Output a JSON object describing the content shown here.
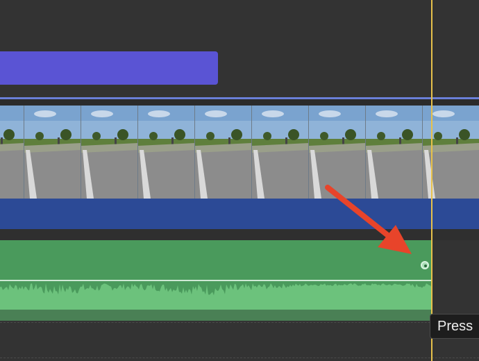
{
  "timeline": {
    "title_clip": {
      "color": "#5a54d4"
    },
    "video_clip": {
      "thumbnail_count": 9,
      "color": "#2c4a96"
    },
    "audio_clip": {
      "color": "#4a9a5c",
      "waveform_color": "#6cc27c"
    },
    "playhead": {
      "color": "#e8c24a"
    }
  },
  "tooltip": {
    "text": "Press"
  },
  "annotation": {
    "arrow_color": "#e8442a"
  }
}
